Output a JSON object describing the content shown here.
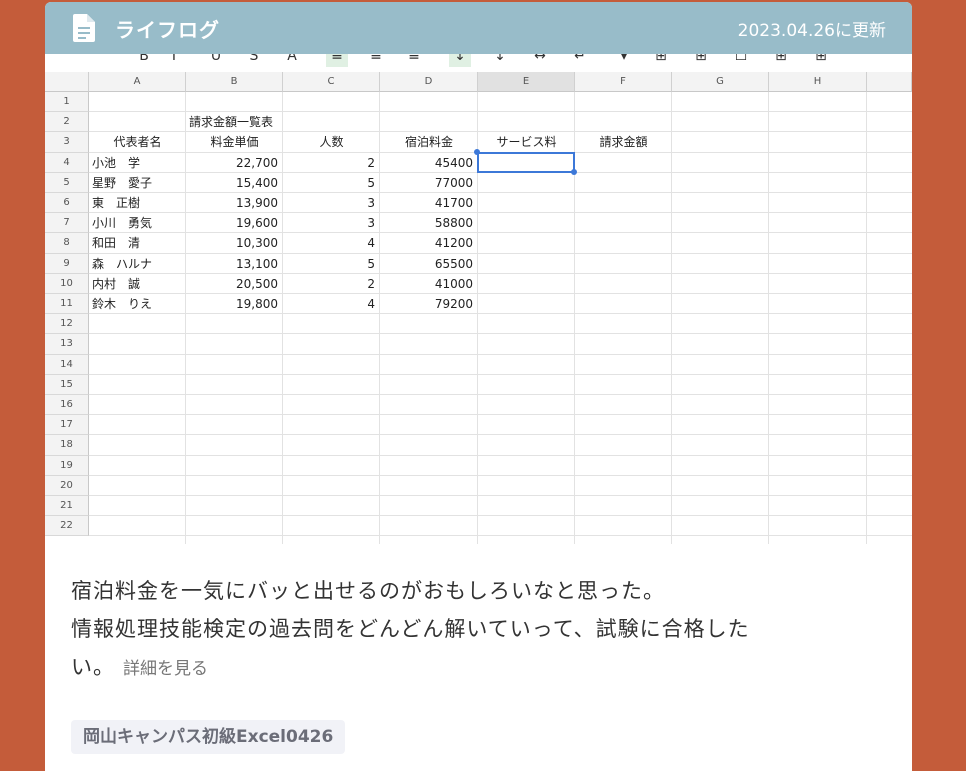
{
  "header": {
    "title": "ライフログ",
    "updated": "2023.04.26に更新"
  },
  "toolbar_glyphs": [
    "B",
    "I",
    "U",
    "S",
    "A",
    "≡",
    "≡",
    "≡",
    "↓",
    "↕",
    "↔",
    "↵",
    "▾",
    "⊞",
    "⊞",
    "☐",
    "⊞",
    "⊞"
  ],
  "spreadsheet": {
    "columns": [
      "A",
      "B",
      "C",
      "D",
      "E",
      "F",
      "G",
      "H"
    ],
    "rows": [
      "1",
      "2",
      "3",
      "4",
      "5",
      "6",
      "7",
      "8",
      "9",
      "10",
      "11",
      "12",
      "13",
      "14",
      "15",
      "16",
      "17",
      "18",
      "19",
      "20",
      "21",
      "22"
    ],
    "title_cell": "請求金額一覧表",
    "headers": [
      "代表者名",
      "料金単価",
      "人数",
      "宿泊料金",
      "サービス料",
      "請求金額"
    ],
    "data": [
      [
        "小池　学",
        "22,700",
        "2",
        "45400"
      ],
      [
        "星野　愛子",
        "15,400",
        "5",
        "77000"
      ],
      [
        "東　正樹",
        "13,900",
        "3",
        "41700"
      ],
      [
        "小川　勇気",
        "19,600",
        "3",
        "58800"
      ],
      [
        "和田　清",
        "10,300",
        "4",
        "41200"
      ],
      [
        "森　ハルナ",
        "13,100",
        "5",
        "65500"
      ],
      [
        "内村　誠",
        "20,500",
        "2",
        "41000"
      ],
      [
        "鈴木　りえ",
        "19,800",
        "4",
        "79200"
      ]
    ],
    "selected_cell": "E4"
  },
  "post": {
    "line1": "宿泊料金を一気にバッと出せるのがおもしろいなと思った。",
    "line2": "情報処理技能検定の過去問をどんどん解いていって、試験に合格した",
    "line3": "い。",
    "more_label": "詳細を見る"
  },
  "tag": "岡山キャンパス初級Excel0426",
  "colors": {
    "background": "#c45c3a",
    "header": "#98bcc9",
    "selection": "#3c78d8"
  }
}
